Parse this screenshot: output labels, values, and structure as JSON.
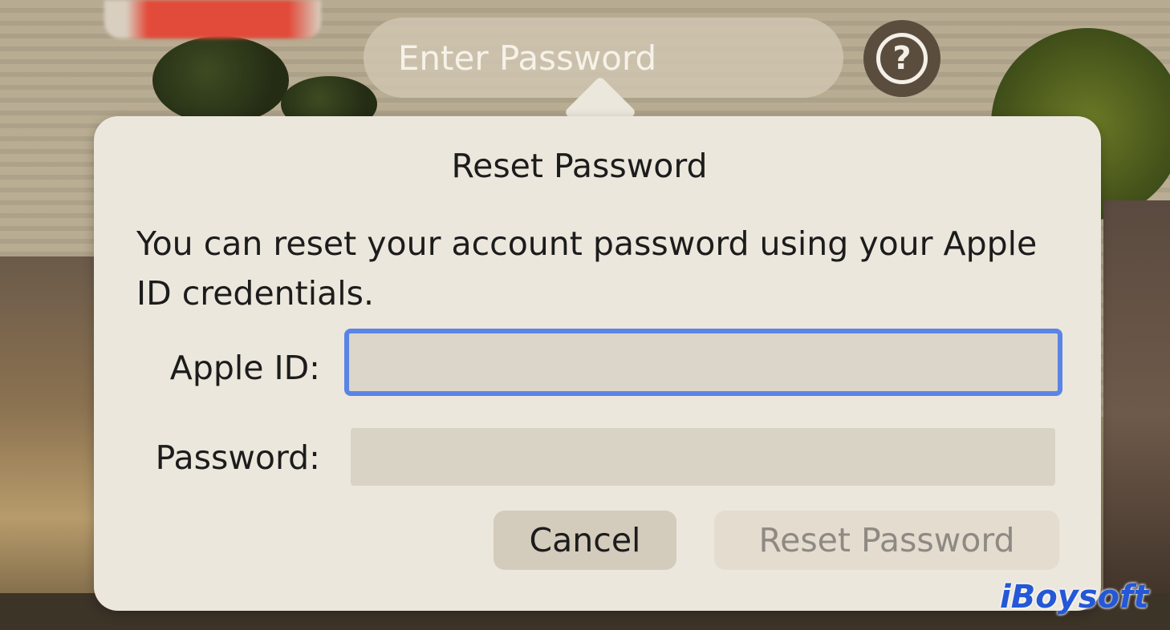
{
  "top_bar": {
    "title": "Enter Password",
    "help_glyph": "?"
  },
  "dialog": {
    "title": "Reset Password",
    "description": "You can reset your account password using your Apple ID credentials.",
    "apple_id_label": "Apple ID:",
    "apple_id_value": "",
    "password_label": "Password:",
    "password_value": "",
    "cancel_label": "Cancel",
    "reset_label": "Reset Password"
  },
  "watermark": "iBoysoft",
  "colors": {
    "focus_ring": "#5a84e6",
    "watermark": "#2458d6",
    "dialog_bg": "#ece7dc"
  },
  "icons": {
    "help": "question-circle-icon"
  }
}
